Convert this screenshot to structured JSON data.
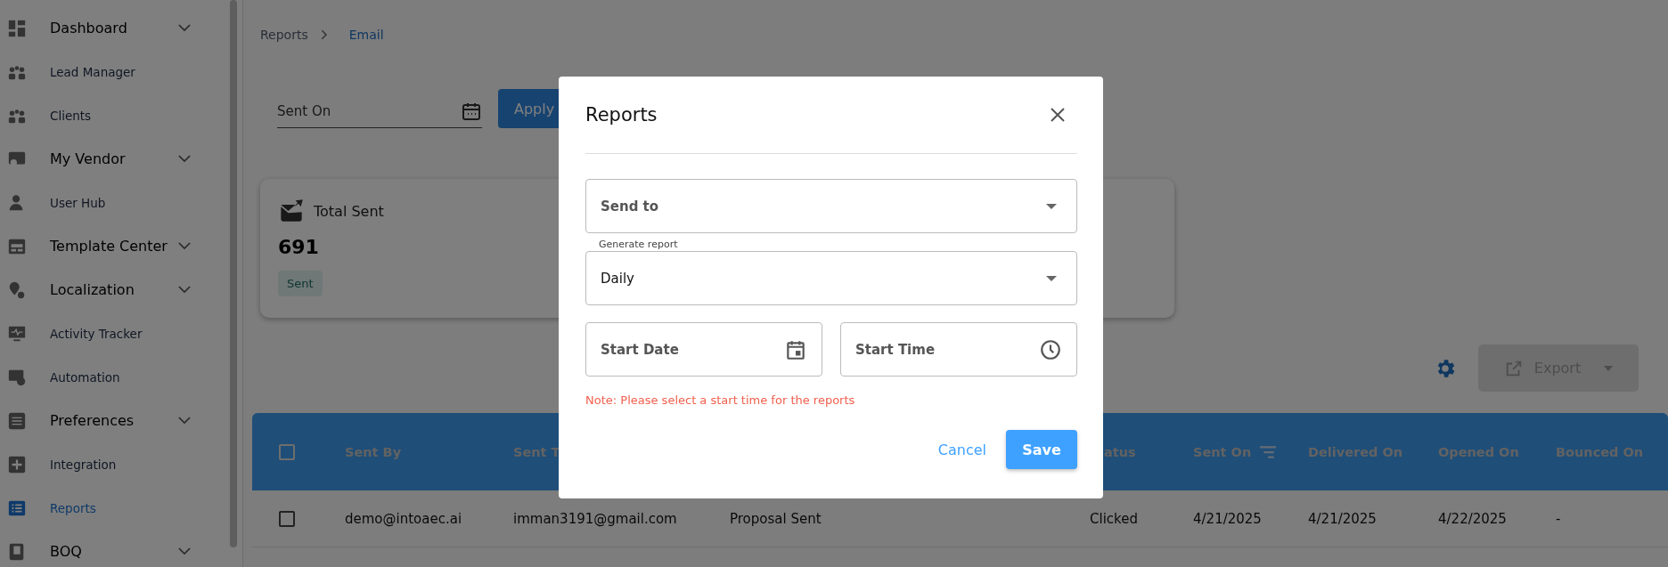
{
  "sidebar": {
    "items": [
      {
        "label": "Dashboard",
        "kind": "group",
        "selected": false
      },
      {
        "label": "Lead Manager",
        "kind": "link",
        "selected": false
      },
      {
        "label": "Clients",
        "kind": "link",
        "selected": false
      },
      {
        "label": "My Vendor",
        "kind": "group",
        "selected": false
      },
      {
        "label": "User Hub",
        "kind": "link",
        "selected": false
      },
      {
        "label": "Template Center",
        "kind": "group",
        "selected": false
      },
      {
        "label": "Localization",
        "kind": "group",
        "selected": false
      },
      {
        "label": "Activity Tracker",
        "kind": "link",
        "selected": false
      },
      {
        "label": "Automation",
        "kind": "link",
        "selected": false
      },
      {
        "label": "Preferences",
        "kind": "group",
        "selected": false
      },
      {
        "label": "Integration",
        "kind": "link",
        "selected": false
      },
      {
        "label": "Reports",
        "kind": "link",
        "selected": true
      },
      {
        "label": "BOQ",
        "kind": "group",
        "selected": false
      }
    ]
  },
  "breadcrumb": [
    {
      "label": "Reports",
      "selected": false
    },
    {
      "label": "Email",
      "selected": true
    }
  ],
  "filter": {
    "placeholder": "Sent On",
    "apply": "Apply"
  },
  "card": {
    "title": "Total Sent",
    "value": "691",
    "tag": "Sent"
  },
  "toolbar": {
    "export": {
      "label": "Export",
      "disabled": true
    }
  },
  "table": {
    "header_checked": false,
    "columns": [
      {
        "label": "Sent By",
        "sortable": false
      },
      {
        "label": "Sent T",
        "sortable": false
      },
      {},
      {
        "label": "atus",
        "sortable": false
      },
      {
        "label": "Sent On",
        "sortable": true
      },
      {
        "label": "Delivered On",
        "sortable": false
      },
      {
        "label": "Opened On",
        "sortable": false
      },
      {
        "label": "Bounced On",
        "sortable": false
      }
    ],
    "rows": [
      {
        "checked": false,
        "cells": [
          "demo@intoaec.ai",
          "imman3191@gmail.com",
          "Proposal Sent",
          "Clicked",
          "4/21/2025",
          "4/21/2025",
          "4/22/2025",
          "-"
        ]
      }
    ]
  },
  "dialog": {
    "title": "Reports",
    "send_to": {
      "placeholder": "Send to"
    },
    "generate_report": {
      "label": "Generate report",
      "value": "Daily"
    },
    "start_date": {
      "placeholder": "Start Date"
    },
    "start_time": {
      "placeholder": "Start Time"
    },
    "note": "Note: Please select a start time for the reports",
    "buttons": {
      "cancel": "Cancel",
      "save": "Save"
    }
  }
}
